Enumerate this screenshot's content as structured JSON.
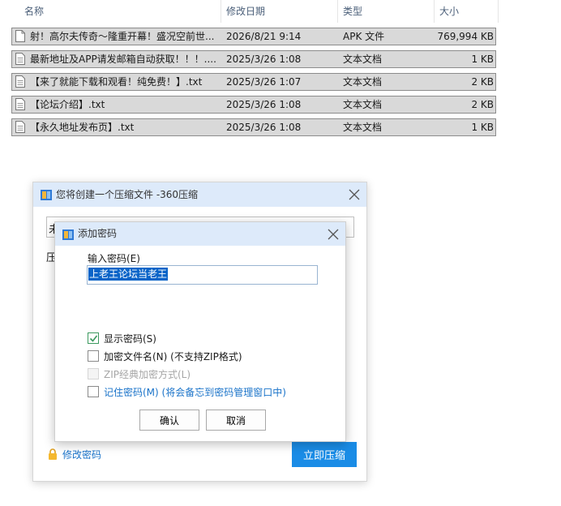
{
  "explorer": {
    "columns": {
      "name": "名称",
      "date": "修改日期",
      "type": "类型",
      "size": "大小"
    },
    "files": [
      {
        "name": "射！高尔夫传奇～隆重开幕！盛况空前世...",
        "date": "2026/8/21 9:14",
        "type": "APK 文件",
        "size": "769,994 KB"
      },
      {
        "name": "最新地址及APP请发邮箱自动获取！！！....",
        "date": "2025/3/26 1:08",
        "type": "文本文档",
        "size": "1 KB"
      },
      {
        "name": "【来了就能下载和观看！纯免费！】.txt",
        "date": "2025/3/26 1:07",
        "type": "文本文档",
        "size": "2 KB"
      },
      {
        "name": "【论坛介绍】.txt",
        "date": "2025/3/26 1:08",
        "type": "文本文档",
        "size": "2 KB"
      },
      {
        "name": "【永久地址发布页】.txt",
        "date": "2025/3/26 1:08",
        "type": "文本文档",
        "size": "1 KB"
      }
    ]
  },
  "compress_dialog": {
    "title": "您将创建一个压缩文件 -360压缩",
    "path_partial": "未",
    "left_label_partial": "压",
    "modify_password": "修改密码",
    "start_button": "立即压缩"
  },
  "password_dialog": {
    "title": "添加密码",
    "password_label": "输入密码(E)",
    "password_value": "上老王论坛当老王",
    "options": {
      "show_password": "显示密码(S)",
      "encrypt_filenames": "加密文件名(N) (不支持ZIP格式)",
      "zip_classic": "ZIP经典加密方式(L)",
      "remember_password": "记住密码(M) (将会备忘到密码管理窗口中)"
    },
    "ok_button": "确认",
    "cancel_button": "取消"
  },
  "colors": {
    "accent": "#1a8ce6",
    "title_bar": "#ddeafa",
    "link": "#1a73c9",
    "selection": "#0a64c8",
    "row_highlight": "#d9d9d9"
  }
}
